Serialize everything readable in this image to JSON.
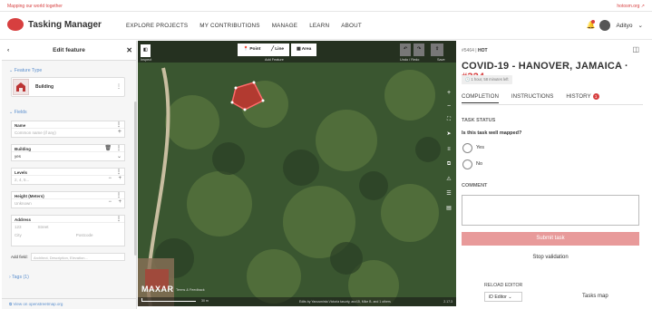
{
  "topstrip": {
    "tagline": "Mapping our world together",
    "org_link": "hotosm.org ↗"
  },
  "nav": {
    "logo_text": "Tasking Manager",
    "links": [
      "EXPLORE PROJECTS",
      "MY CONTRIBUTIONS",
      "MANAGE",
      "LEARN",
      "ABOUT"
    ],
    "username": "Adityo",
    "chevron": "⌄"
  },
  "editor": {
    "title": "Edit feature",
    "back": "‹",
    "close": "✕",
    "feature_type_label": "Feature Type",
    "feature_type_value": "Building",
    "fields_label": "Fields",
    "fields": [
      {
        "label": "Name",
        "placeholder": "Common name (if any)"
      },
      {
        "label": "Building",
        "value": "yes"
      },
      {
        "label": "Levels",
        "placeholder": "2, 4, 5..."
      },
      {
        "label": "Height (Meters)",
        "placeholder": "Unknown"
      },
      {
        "label": "Address",
        "street_no": "123",
        "street": "Street",
        "city": "City",
        "postcode": "Postcode"
      }
    ],
    "add_field_label": "Add field:",
    "add_field_placeholder": "Architect, Description, Elevation...",
    "tags_label": "Tags (1)",
    "footer_link": "View on openstreetmap.org"
  },
  "map": {
    "inspect_label": "Inspect",
    "add_feature_label": "Add Feature",
    "undo_redo_label": "Undo / Redo",
    "save_label": "Save",
    "modes": [
      "Point",
      "Line",
      "Area"
    ],
    "scale": "30 m",
    "credit": "Edits by Yanusminta Victoria tasurty, anz15, Mike B. and 1 others",
    "maxar": "MAXAR",
    "imagery_terms": "Terms & Feedback",
    "version": "2.17.3"
  },
  "task": {
    "project_id": "#5464",
    "org": "HOT",
    "title": "COVID-19 - HANOVER, JAMAICA · ",
    "task_number": "#324",
    "time_left": "1 hour, 58 minutes left",
    "tabs": [
      "COMPLETION",
      "INSTRUCTIONS",
      "HISTORY"
    ],
    "history_count": "1",
    "status_heading": "TASK STATUS",
    "question": "Is this task well mapped?",
    "option_yes": "Yes",
    "option_no": "No",
    "comment_heading": "COMMENT",
    "submit_label": "Submit task",
    "stop_label": "Stop validation",
    "reload_label": "RELOAD EDITOR",
    "editor_select": "iD Editor",
    "tasks_map": "Tasks map"
  },
  "colors": {
    "brand": "#d73f3f",
    "link": "#5b8fce",
    "submit": "#e89a9a"
  }
}
